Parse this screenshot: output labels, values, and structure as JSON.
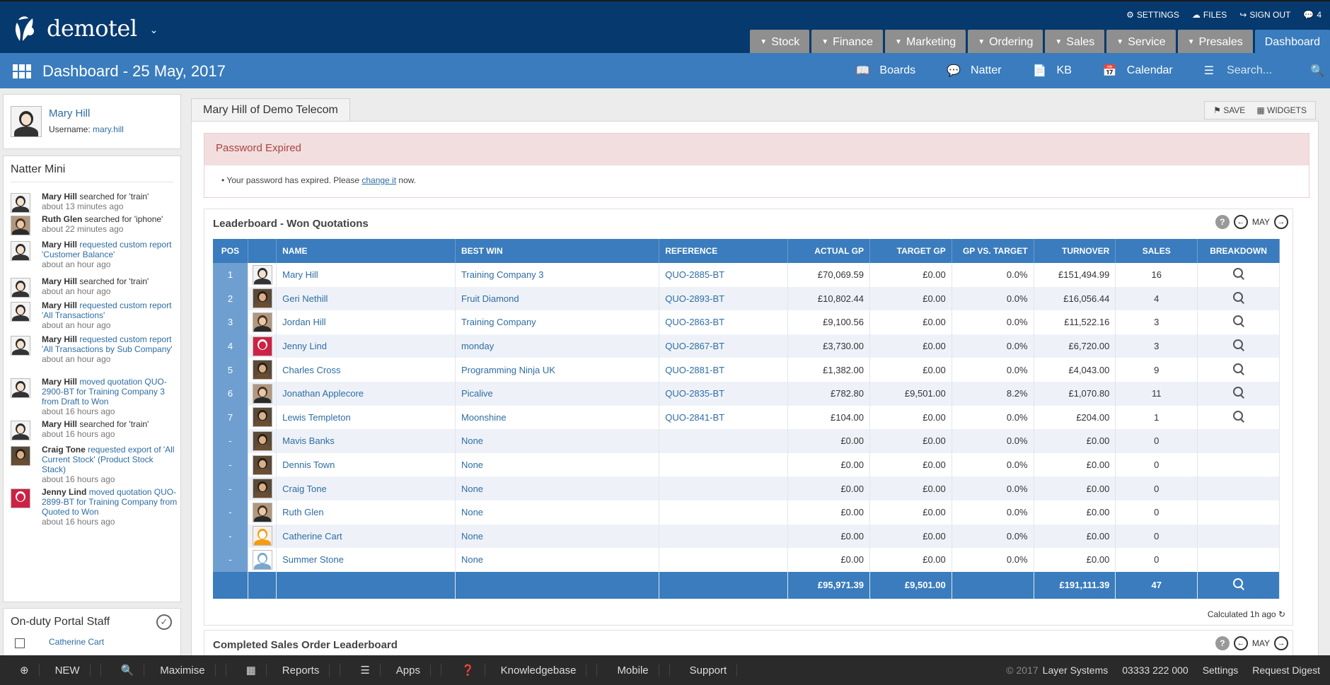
{
  "app": {
    "name": "demotel"
  },
  "top_links": {
    "settings": "SETTINGS",
    "files": "FILES",
    "signout": "SIGN OUT",
    "chat_count": "4"
  },
  "nav_tabs": [
    {
      "label": "Stock"
    },
    {
      "label": "Finance"
    },
    {
      "label": "Marketing"
    },
    {
      "label": "Ordering"
    },
    {
      "label": "Sales"
    },
    {
      "label": "Service"
    },
    {
      "label": "Presales"
    },
    {
      "label": "Dashboard"
    }
  ],
  "subbar": {
    "title": "Dashboard - 25 May, 2017",
    "boards": "Boards",
    "natter": "Natter",
    "kb": "KB",
    "calendar": "Calendar",
    "search_placeholder": "Search..."
  },
  "user": {
    "name": "Mary Hill",
    "username_label": "Username:",
    "username": "mary.hill"
  },
  "natter_mini": {
    "title": "Natter Mini",
    "items": [
      {
        "who": "Mary Hill",
        "pre": "searched for 'train'",
        "link": "",
        "time": "about 13 minutes ago"
      },
      {
        "who": "Ruth Glen",
        "pre": "searched for 'iphone'",
        "link": "",
        "time": "about 22 minutes ago"
      },
      {
        "who": "Mary Hill",
        "pre": "",
        "link": "requested custom report 'Customer Balance'",
        "time": "about an hour ago"
      },
      {
        "who": "Mary Hill",
        "pre": "searched for 'train'",
        "link": "",
        "time": "about an hour ago"
      },
      {
        "who": "Mary Hill",
        "pre": "",
        "link": "requested custom report 'All Transactions'",
        "time": "about an hour ago"
      },
      {
        "who": "Mary Hill",
        "pre": "",
        "link": "requested custom report 'All Transactions by Sub Company'",
        "time": "about an hour ago"
      },
      {
        "who": "Mary Hill",
        "pre": "",
        "link": "moved quotation QUO-2900-BT for Training Company 3 from Draft to Won",
        "time": "about 16 hours ago"
      },
      {
        "who": "Mary Hill",
        "pre": "searched for 'train'",
        "link": "",
        "time": "about 16 hours ago"
      },
      {
        "who": "Craig Tone",
        "pre": "",
        "link": "requested export of 'All Current Stock' (Product Stock Stack)",
        "time": "about 16 hours ago"
      },
      {
        "who": "Jenny Lind",
        "pre": "",
        "link": "moved quotation QUO-2899-BT for Training Company from Quoted to Won",
        "time": "about 16 hours ago"
      }
    ]
  },
  "onduty": {
    "title": "On-duty Portal Staff",
    "first": "Catherine Cart"
  },
  "main": {
    "page_tab": "Mary Hill of Demo Telecom",
    "save": "SAVE",
    "widgets": "WIDGETS",
    "alert_title": "Password Expired",
    "alert_pre": "Your password has expired. Please",
    "alert_link": "change it",
    "alert_post": "now."
  },
  "leaderboard": {
    "title": "Leaderboard - Won Quotations",
    "month": "MAY",
    "columns": [
      "POS",
      "",
      "NAME",
      "BEST WIN",
      "REFERENCE",
      "ACTUAL GP",
      "TARGET GP",
      "GP VS. TARGET",
      "TURNOVER",
      "SALES",
      "BREAKDOWN"
    ],
    "rows": [
      {
        "pos": "1",
        "name": "Mary Hill",
        "best": "Training Company 3",
        "ref": "QUO-2885-BT",
        "agp": "£70,069.59",
        "tgp": "£0.00",
        "vs": "0.0%",
        "turn": "£151,494.99",
        "sales": "16",
        "bd": true
      },
      {
        "pos": "2",
        "name": "Geri Nethill",
        "best": "Fruit Diamond",
        "ref": "QUO-2893-BT",
        "agp": "£10,802.44",
        "tgp": "£0.00",
        "vs": "0.0%",
        "turn": "£16,056.44",
        "sales": "4",
        "bd": true
      },
      {
        "pos": "3",
        "name": "Jordan Hill",
        "best": "Training Company",
        "ref": "QUO-2863-BT",
        "agp": "£9,100.56",
        "tgp": "£0.00",
        "vs": "0.0%",
        "turn": "£11,522.16",
        "sales": "3",
        "bd": true
      },
      {
        "pos": "4",
        "name": "Jenny Lind",
        "best": "monday",
        "ref": "QUO-2867-BT",
        "agp": "£3,730.00",
        "tgp": "£0.00",
        "vs": "0.0%",
        "turn": "£6,720.00",
        "sales": "3",
        "bd": true
      },
      {
        "pos": "5",
        "name": "Charles Cross",
        "best": "Programming Ninja UK",
        "ref": "QUO-2881-BT",
        "agp": "£1,382.00",
        "tgp": "£0.00",
        "vs": "0.0%",
        "turn": "£4,043.00",
        "sales": "9",
        "bd": true
      },
      {
        "pos": "6",
        "name": "Jonathan Applecore",
        "best": "Picalive",
        "ref": "QUO-2835-BT",
        "agp": "£782.80",
        "tgp": "£9,501.00",
        "vs": "8.2%",
        "turn": "£1,070.80",
        "sales": "11",
        "bd": true
      },
      {
        "pos": "7",
        "name": "Lewis Templeton",
        "best": "Moonshine",
        "ref": "QUO-2841-BT",
        "agp": "£104.00",
        "tgp": "£0.00",
        "vs": "0.0%",
        "turn": "£204.00",
        "sales": "1",
        "bd": true
      },
      {
        "pos": "-",
        "name": "Mavis Banks",
        "best": "None",
        "ref": "",
        "agp": "£0.00",
        "tgp": "£0.00",
        "vs": "0.0%",
        "turn": "£0.00",
        "sales": "0",
        "bd": false
      },
      {
        "pos": "-",
        "name": "Dennis Town",
        "best": "None",
        "ref": "",
        "agp": "£0.00",
        "tgp": "£0.00",
        "vs": "0.0%",
        "turn": "£0.00",
        "sales": "0",
        "bd": false
      },
      {
        "pos": "-",
        "name": "Craig Tone",
        "best": "None",
        "ref": "",
        "agp": "£0.00",
        "tgp": "£0.00",
        "vs": "0.0%",
        "turn": "£0.00",
        "sales": "0",
        "bd": false
      },
      {
        "pos": "-",
        "name": "Ruth Glen",
        "best": "None",
        "ref": "",
        "agp": "£0.00",
        "tgp": "£0.00",
        "vs": "0.0%",
        "turn": "£0.00",
        "sales": "0",
        "bd": false
      },
      {
        "pos": "-",
        "name": "Catherine Cart",
        "best": "None",
        "ref": "",
        "agp": "£0.00",
        "tgp": "£0.00",
        "vs": "0.0%",
        "turn": "£0.00",
        "sales": "0",
        "bd": false
      },
      {
        "pos": "-",
        "name": "Summer Stone",
        "best": "None",
        "ref": "",
        "agp": "£0.00",
        "tgp": "£0.00",
        "vs": "0.0%",
        "turn": "£0.00",
        "sales": "0",
        "bd": false
      }
    ],
    "totals": {
      "agp": "£95,971.39",
      "tgp": "£9,501.00",
      "turn": "£191,111.39",
      "sales": "47"
    },
    "calculated": "Calculated 1h ago"
  },
  "leaderboard2": {
    "title": "Completed Sales Order Leaderboard",
    "month": "MAY"
  },
  "statusbar": {
    "new": "NEW",
    "maximise": "Maximise",
    "reports": "Reports",
    "apps": "Apps",
    "kb": "Knowledgebase",
    "mobile": "Mobile",
    "support": "Support",
    "copyright": "© 2017",
    "company": "Layer Systems",
    "phone": "03333 222 000",
    "settings": "Settings",
    "digest": "Request Digest"
  },
  "colors": {
    "topbar": "#06396d",
    "accent": "#3a7cbd",
    "tab_inactive": "#8f8f8f",
    "alert_bg": "#f2dede"
  }
}
